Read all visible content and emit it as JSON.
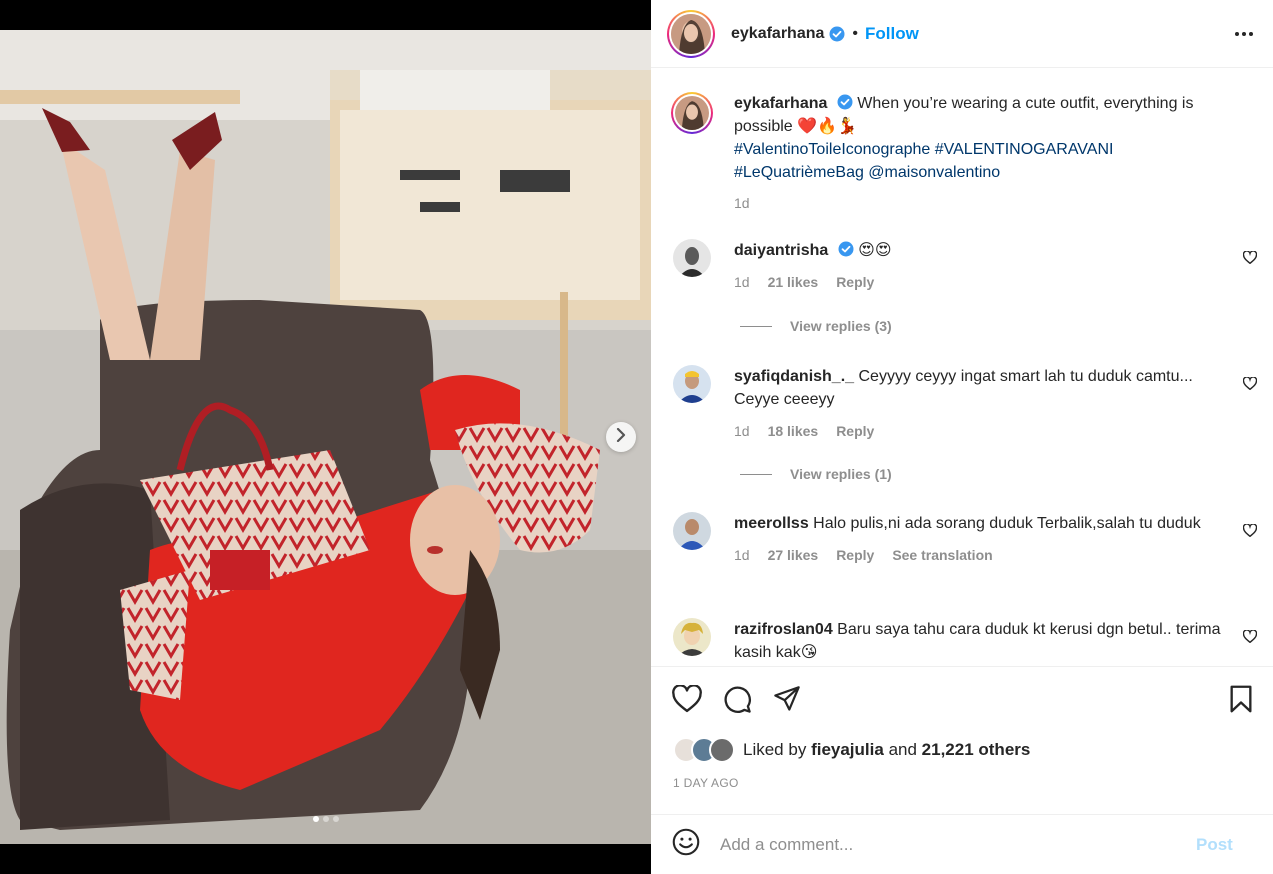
{
  "header": {
    "username": "eykafarhana",
    "separator": "•",
    "follow_label": "Follow"
  },
  "caption": {
    "username": "eykafarhana",
    "text": "When you’re wearing a cute outfit, everything is possible",
    "emojis": "❤️🔥💃",
    "hashtags_line1": "#ValentinoToileIconographe #VALENTINOGARAVANI",
    "hashtags_line2": "#LeQuatrièmeBag @maisonvalentino",
    "time": "1d"
  },
  "comments": [
    {
      "username": "daiyantrisha",
      "text": "😍😍",
      "time": "1d",
      "likes": "21 likes",
      "reply": "Reply",
      "view_replies": "View replies (3)"
    },
    {
      "username": "syafiqdanish_._",
      "text": "Ceyyyy ceyyy ingat smart lah tu duduk camtu... Ceyye ceeeyy",
      "time": "1d",
      "likes": "18 likes",
      "reply": "Reply",
      "view_replies": "View replies (1)"
    },
    {
      "username": "meerollss",
      "text": "Halo pulis,ni ada sorang duduk Terbalik,salah tu duduk",
      "time": "1d",
      "likes": "27 likes",
      "reply": "Reply",
      "translation": "See translation"
    },
    {
      "username": "razifroslan04",
      "text": "Baru saya tahu cara duduk kt kerusi dgn betul.. terima kasih kak😘"
    }
  ],
  "likes": {
    "prefix": "Liked by",
    "user": "fieyajulia",
    "and": "and",
    "others": "21,221 others"
  },
  "timestamp": "1 DAY AGO",
  "add_comment": {
    "placeholder": "Add a comment...",
    "post_label": "Post"
  },
  "carousel": {
    "current": 1,
    "total": 3
  },
  "colors": {
    "accent": "#0095f6",
    "hashtag": "#00376b",
    "muted": "#8e8e8e",
    "post_disabled": "#b2dffc"
  },
  "icons": [
    "verified-badge-icon",
    "more-options-icon",
    "heart-icon",
    "comment-icon",
    "share-icon",
    "bookmark-icon",
    "emoji-icon",
    "chevron-right-icon"
  ]
}
